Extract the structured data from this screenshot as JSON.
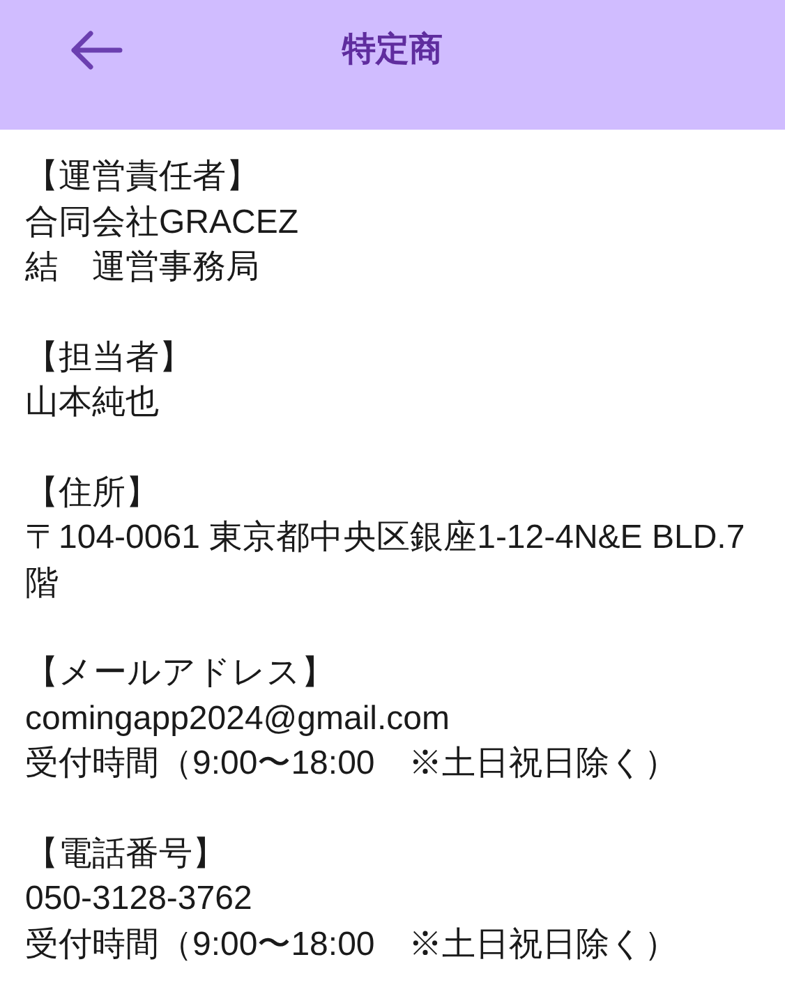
{
  "header": {
    "title": "特定商"
  },
  "sections": [
    {
      "heading": "【運営責任者】",
      "lines": [
        "合同会社GRACEZ",
        "結　運営事務局"
      ]
    },
    {
      "heading": "【担当者】",
      "lines": [
        "山本純也"
      ]
    },
    {
      "heading": "【住所】",
      "lines": [
        "〒104-0061 東京都中央区銀座1-12-4N&E BLD.7階"
      ]
    },
    {
      "heading": "【メールアドレス】",
      "lines": [
        "comingapp2024@gmail.com",
        "受付時間（9:00〜18:00　※土日祝日除く）"
      ]
    },
    {
      "heading": "【電話番号】",
      "lines": [
        "050-3128-3762",
        "受付時間（9:00〜18:00　※土日祝日除く）"
      ]
    }
  ]
}
